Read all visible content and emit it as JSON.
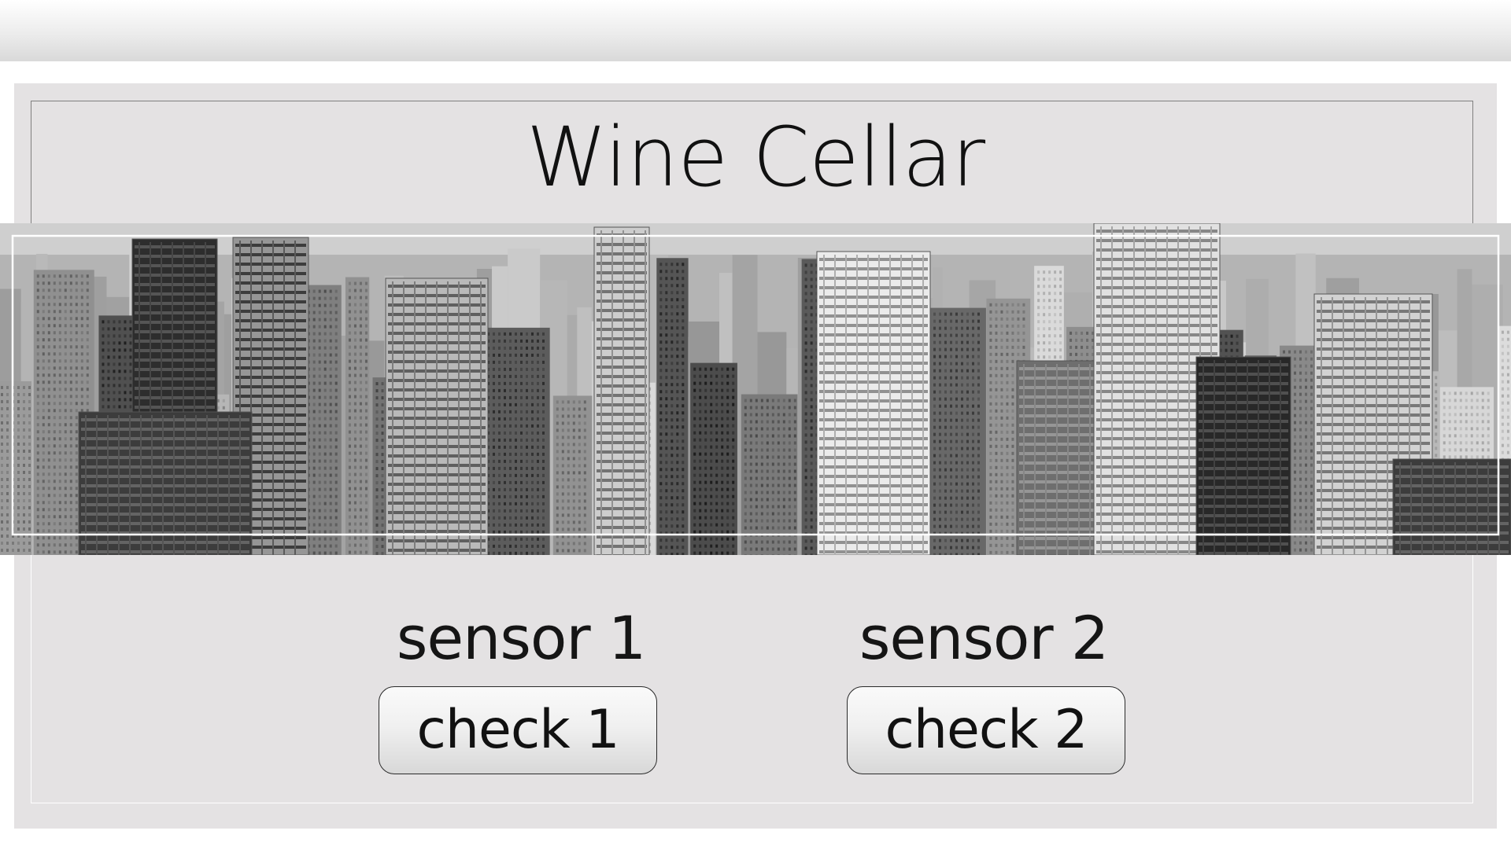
{
  "app": {
    "title": "Wine Cellar"
  },
  "banner": {
    "image": "city-skyline-grayscale"
  },
  "sensors": [
    {
      "label": "sensor 1",
      "button_label": "check 1"
    },
    {
      "label": "sensor 2",
      "button_label": "check 2"
    }
  ],
  "colors": {
    "panel_background": "#e4e2e3",
    "text": "#111111",
    "button_border": "#2a2a2a"
  }
}
